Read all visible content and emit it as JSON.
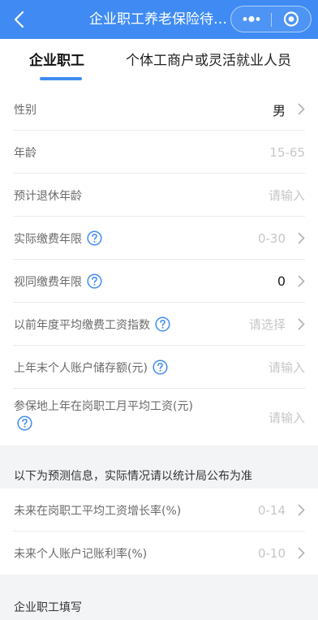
{
  "nav": {
    "title": "企业职工养老保险待遇测算"
  },
  "tabs": [
    "企业职工",
    "个体工商户或灵活就业人员"
  ],
  "rows": [
    {
      "label": "性别",
      "value": "男"
    },
    {
      "label": "年龄",
      "value": "15-65"
    },
    {
      "label": "预计退休年龄",
      "value": "请输入"
    },
    {
      "label": "实际缴费年限",
      "value": "0-30"
    },
    {
      "label": "视同缴费年限",
      "value": "0"
    },
    {
      "label": "以前年度平均缴费工资指数",
      "value": "请选择"
    },
    {
      "label": "上年末个人账户储存额(元)",
      "value": "请输入"
    },
    {
      "label": "参保地上年在岗职工月平均工资(元)",
      "value": "请输入"
    }
  ],
  "forecast": {
    "heading": "以下为预测信息，实际情况请以统计局公布为准",
    "rows": [
      {
        "label": "未来在岗职工平均工资增长率(%)",
        "value": "0-14"
      },
      {
        "label": "未来个人账户记账利率(%)",
        "value": "0-10"
      }
    ]
  },
  "footer": {
    "section_title": "企业职工填写"
  },
  "colors": {
    "primary": "#3F8BF3",
    "background": "#F3F4F6",
    "placeholder": "#C7C7C7"
  }
}
